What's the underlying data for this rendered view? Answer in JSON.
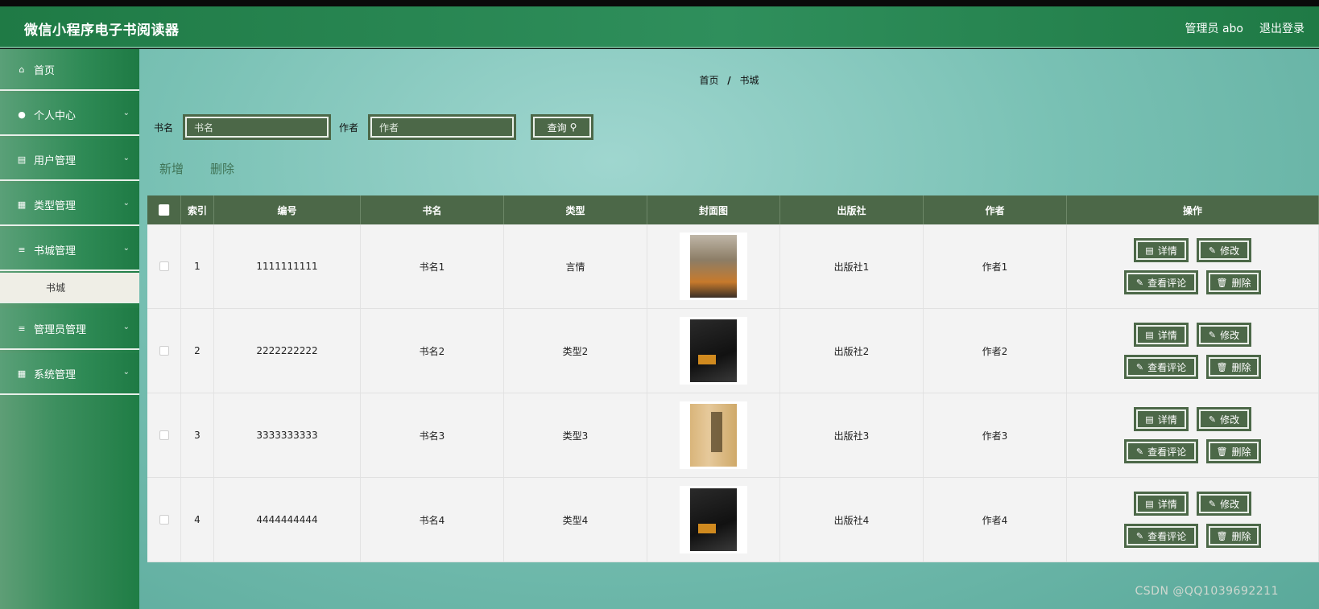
{
  "app": {
    "title": "微信小程序电子书阅读器",
    "user": "管理员 abo",
    "logout": "退出登录"
  },
  "sidebar": {
    "items": [
      {
        "label": "首页",
        "icon": "home-icon"
      },
      {
        "label": "个人中心",
        "icon": "user-icon"
      },
      {
        "label": "用户管理",
        "icon": "document-icon"
      },
      {
        "label": "类型管理",
        "icon": "grid-icon"
      },
      {
        "label": "书城管理",
        "icon": "list-icon"
      },
      {
        "label": "管理员管理",
        "icon": "list-icon"
      },
      {
        "label": "系统管理",
        "icon": "apps-icon"
      }
    ],
    "submenu": {
      "label": "书城"
    }
  },
  "breadcrumb": {
    "home": "首页",
    "sep": "/",
    "current": "书城"
  },
  "search": {
    "book_label": "书名",
    "book_placeholder": "书名",
    "author_label": "作者",
    "author_placeholder": "作者",
    "query_label": "查询"
  },
  "actions": {
    "add": "新增",
    "delete": "删除"
  },
  "table": {
    "headers": [
      "索引",
      "编号",
      "书名",
      "类型",
      "封面图",
      "出版社",
      "作者",
      "操作"
    ],
    "rows": [
      {
        "index": "1",
        "code": "1111111111",
        "name": "书名1",
        "type": "言情",
        "publisher": "出版社1",
        "author": "作者1"
      },
      {
        "index": "2",
        "code": "2222222222",
        "name": "书名2",
        "type": "类型2",
        "publisher": "出版社2",
        "author": "作者2"
      },
      {
        "index": "3",
        "code": "3333333333",
        "name": "书名3",
        "type": "类型3",
        "publisher": "出版社3",
        "author": "作者3"
      },
      {
        "index": "4",
        "code": "4444444444",
        "name": "书名4",
        "type": "类型4",
        "publisher": "出版社4",
        "author": "作者4"
      }
    ],
    "op_labels": {
      "detail": "详情",
      "edit": "修改",
      "comments": "查看评论",
      "delete": "删除"
    }
  },
  "watermark": "CSDN @QQ1039692211",
  "colors": {
    "header": "#2a8a55",
    "button": "#4c6848",
    "sidebar": "#2e8a55"
  }
}
